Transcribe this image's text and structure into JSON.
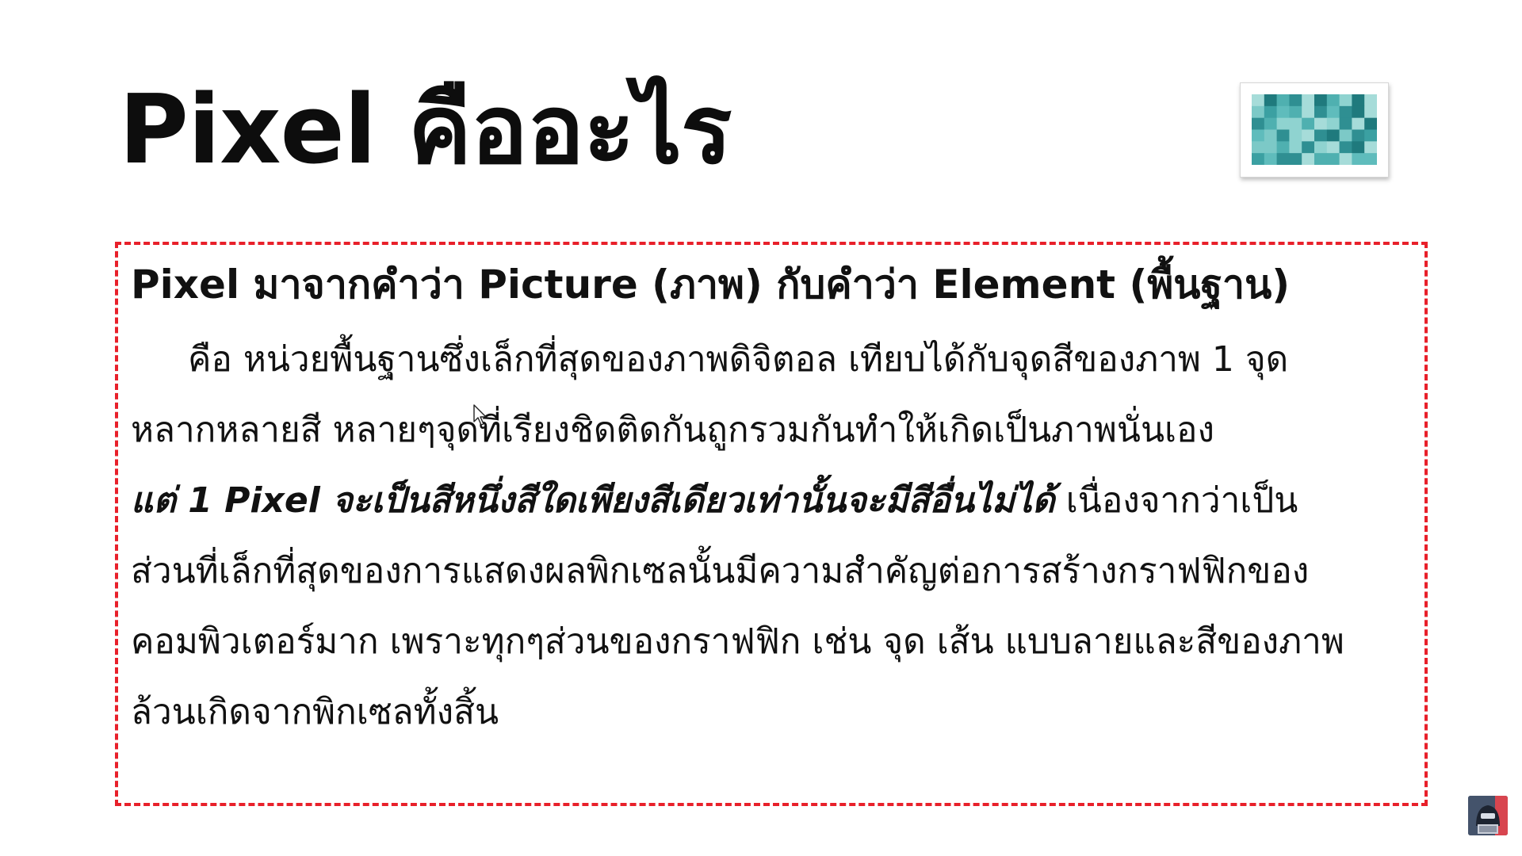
{
  "slide": {
    "title": "Pixel คืออะไร"
  },
  "thumbnail": {
    "icon": "pixelated-image-icon",
    "colors": [
      "#4fb0b0",
      "#2f8f92",
      "#7cc9c7",
      "#a6dcd9",
      "#1f7a7d",
      "#5fbcbc",
      "#3ba0a2",
      "#8fd3d0"
    ]
  },
  "content": {
    "heading": "Pixel มาจากคำว่า Picture (ภาพ) กับคำว่า Element (พื้นฐาน)",
    "line1": "คือ หน่วยพื้นฐานซึ่งเล็กที่สุดของภาพดิจิตอล เทียบได้กับจุดสีของภาพ 1 จุด",
    "line2": "หลากหลายสี หลายๆจุดที่เรียงชิดติดกันถูกรวมกันทำให้เกิดเป็นภาพนั่นเอง",
    "line3_emphasis": "แต่ 1  Pixel จะเป็นสีหนึ่งสีใดเพียงสีเดียวเท่านั้นจะมีสีอื่นไม่ได้",
    "line3_rest": " เนื่องจากว่าเป็น",
    "line4": "ส่วนที่เล็กที่สุดของการแสดงผลพิกเซลนั้นมีความสำคัญต่อการสร้างกราฟฟิกของ",
    "line5": "คอมพิวเตอร์มาก เพราะทุกๆส่วนของกราฟฟิก เช่น จุด เส้น แบบลายและสีของภาพ",
    "line6": "ล้วนเกิดจากพิกเซลทั้งสิ้น"
  },
  "style": {
    "border_color": "#e8202a"
  }
}
